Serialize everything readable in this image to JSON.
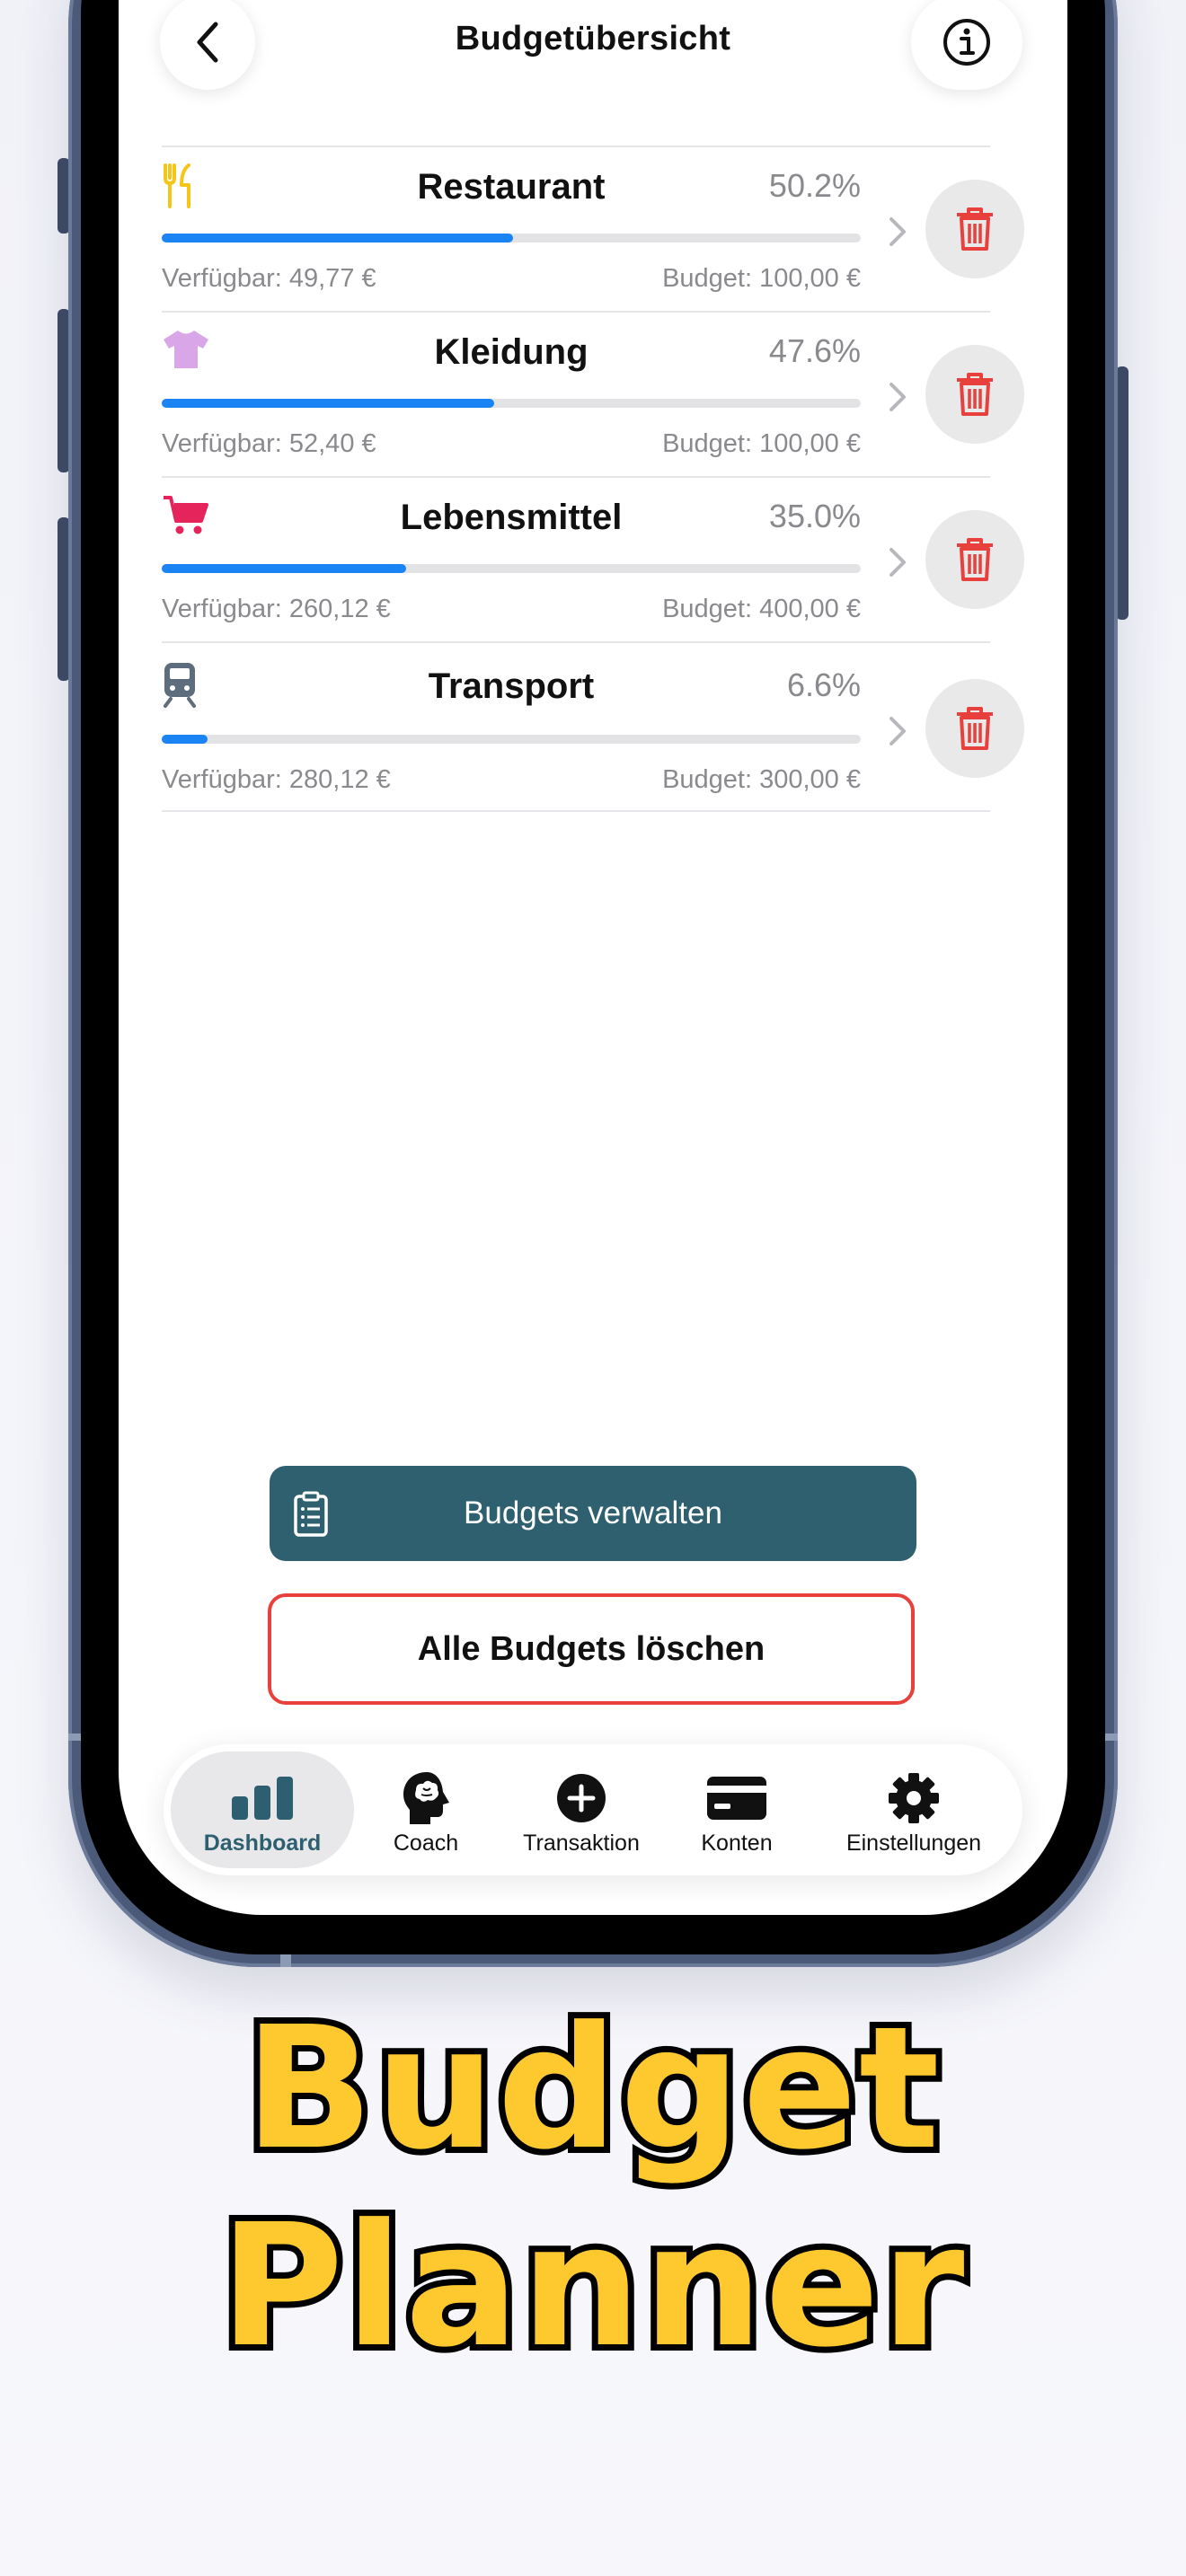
{
  "header": {
    "title": "Budgetübersicht",
    "back_icon": "chevron-left-icon",
    "info_icon": "info-icon"
  },
  "budgets": [
    {
      "name": "Restaurant",
      "percent_label": "50.2%",
      "progress": 0.502,
      "available": "Verfügbar: 49,77 €",
      "budget": "Budget: 100,00 €",
      "icon": "fork-knife-icon",
      "icon_color": "#f5c518"
    },
    {
      "name": "Kleidung",
      "percent_label": "47.6%",
      "progress": 0.476,
      "available": "Verfügbar: 52,40 €",
      "budget": "Budget: 100,00 €",
      "icon": "tshirt-icon",
      "icon_color": "#d9a6e8"
    },
    {
      "name": "Lebensmittel",
      "percent_label": "35.0%",
      "progress": 0.35,
      "available": "Verfügbar: 260,12 €",
      "budget": "Budget: 400,00 €",
      "icon": "shopping-cart-icon",
      "icon_color": "#e6245c"
    },
    {
      "name": "Transport",
      "percent_label": "6.6%",
      "progress": 0.066,
      "available": "Verfügbar: 280,12 €",
      "budget": "Budget: 300,00 €",
      "icon": "train-icon",
      "icon_color": "#5e6d7d"
    }
  ],
  "actions": {
    "manage_label": "Budgets verwalten",
    "delete_all_label": "Alle Budgets löschen"
  },
  "tabbar": {
    "items": [
      {
        "label": "Dashboard",
        "icon": "bar-chart-icon",
        "active": true
      },
      {
        "label": "Coach",
        "icon": "brain-head-icon",
        "active": false
      },
      {
        "label": "Transaktion",
        "icon": "plus-circle-icon",
        "active": false
      },
      {
        "label": "Konten",
        "icon": "credit-card-icon",
        "active": false
      },
      {
        "label": "Einstellungen",
        "icon": "gear-icon",
        "active": false
      }
    ]
  },
  "promo": {
    "line1": "Budget",
    "line2": "Planner"
  },
  "colors": {
    "accent_blue": "#1a84f5",
    "manage_button": "#2e6070",
    "delete_red": "#e8403d",
    "promo_yellow": "#fdc92e"
  }
}
